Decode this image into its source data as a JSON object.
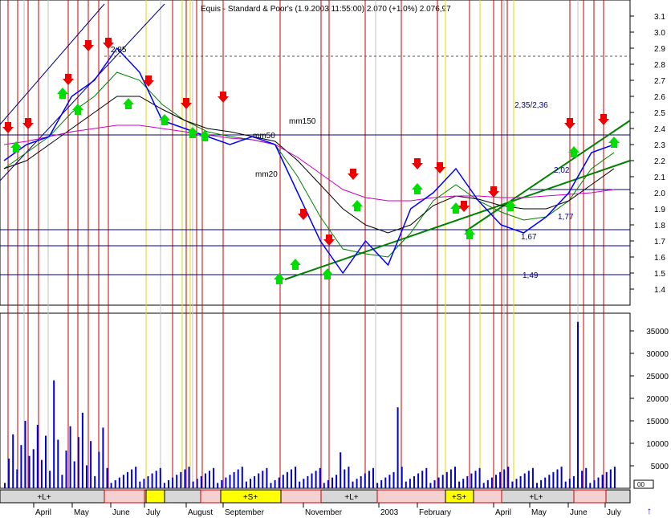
{
  "header": {
    "title": "Equis - Standard & Poor's (1.9.2003 11:55:00) 2.070 (+1.0%) 2.076,97"
  },
  "price_axis": {
    "ticks": [
      "3.1",
      "3.0",
      "2.9",
      "2.8",
      "2.7",
      "2.6",
      "2.5",
      "2.4",
      "2.3",
      "2.2",
      "2.1",
      "2.0",
      "1.9",
      "1.8",
      "1.7",
      "1.6",
      "1.5",
      "1.4"
    ]
  },
  "volume_axis": {
    "ticks": [
      "35000",
      "30000",
      "25000",
      "20000",
      "15000",
      "10000",
      "5000"
    ],
    "tag": "00"
  },
  "annotations": {
    "mm150": "mm150",
    "mm50": "mm50",
    "mm20": "mm20",
    "l285": "2,85",
    "l235": "2,35/2,36",
    "l202": "2,02",
    "l177": "1,77",
    "l167": "1,67",
    "l149": "1,49"
  },
  "months": [
    "April",
    "May",
    "June",
    "July",
    "August",
    "September",
    "November",
    "2003",
    "February",
    "April",
    "May",
    "June",
    "July"
  ],
  "band_labels": [
    "+L+",
    "+S+",
    "+L+",
    "+S+",
    "+L+"
  ],
  "chart_data": {
    "type": "line",
    "title": "",
    "ylim": [
      1.4,
      3.1
    ],
    "volume_ylim": [
      0,
      35000
    ],
    "price_levels": [
      2.85,
      2.36,
      2.02,
      1.77,
      1.67,
      1.49
    ],
    "series": [
      {
        "name": "price",
        "values": [
          2.2,
          2.3,
          2.35,
          2.6,
          2.7,
          2.9,
          2.75,
          2.45,
          2.4,
          2.35,
          2.3,
          2.35,
          2.3,
          2.0,
          1.7,
          1.5,
          1.7,
          1.55,
          1.9,
          2.0,
          2.15,
          1.95,
          1.8,
          1.75,
          1.85,
          2.0,
          2.25,
          2.3
        ]
      },
      {
        "name": "mm20",
        "values": [
          2.15,
          2.25,
          2.35,
          2.5,
          2.6,
          2.75,
          2.7,
          2.55,
          2.45,
          2.38,
          2.35,
          2.33,
          2.3,
          2.1,
          1.85,
          1.65,
          1.62,
          1.6,
          1.75,
          1.95,
          2.05,
          1.95,
          1.88,
          1.83,
          1.85,
          1.95,
          2.15,
          2.25
        ]
      },
      {
        "name": "mm50",
        "values": [
          2.15,
          2.2,
          2.3,
          2.4,
          2.5,
          2.6,
          2.6,
          2.52,
          2.45,
          2.4,
          2.38,
          2.35,
          2.32,
          2.2,
          2.05,
          1.9,
          1.8,
          1.75,
          1.8,
          1.92,
          1.98,
          1.96,
          1.92,
          1.9,
          1.9,
          1.95,
          2.05,
          2.15
        ]
      },
      {
        "name": "mm150",
        "values": [
          2.3,
          2.32,
          2.35,
          2.38,
          2.4,
          2.42,
          2.42,
          2.4,
          2.38,
          2.36,
          2.34,
          2.33,
          2.3,
          2.22,
          2.12,
          2.02,
          1.97,
          1.95,
          1.95,
          1.97,
          1.98,
          1.98,
          1.97,
          1.97,
          1.98,
          1.99,
          2.0,
          2.02
        ]
      }
    ]
  }
}
